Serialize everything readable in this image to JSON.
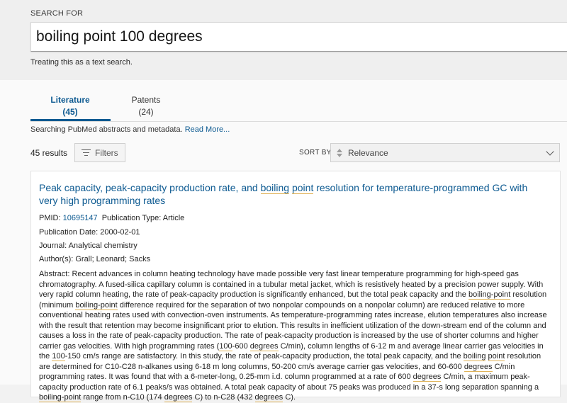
{
  "search": {
    "label": "SEARCH FOR",
    "query": "boiling point 100 degrees",
    "mode_note": "Treating this as a text search."
  },
  "tabs": [
    {
      "label": "Literature",
      "count": "(45)",
      "active": true
    },
    {
      "label": "Patents",
      "count": "(24)",
      "active": false
    }
  ],
  "source": {
    "text": "Searching PubMed abstracts and metadata.",
    "link": "Read More..."
  },
  "toolbar": {
    "results": "45 results",
    "filters_label": "Filters",
    "sort_label": "SORT BY",
    "sort_value": "Relevance"
  },
  "result": {
    "title": {
      "before": "Peak capacity, peak-capacity production rate, and ",
      "hl1": "boiling",
      "mid": " ",
      "hl2": "point",
      "after": " resolution for temperature-programmed GC with very high programming rates"
    },
    "pmid_label": "PMID:",
    "pmid": "10695147",
    "pub_type": "Publication Type: Article",
    "pub_date": "Publication Date: 2000-02-01",
    "journal": "Journal: Analytical chemistry",
    "authors": "Author(s): Grall; Leonard; Sacks",
    "abstract": {
      "s1": "Abstract: Recent advances in column heating technology have made possible very fast linear temperature programming for high-speed gas chromatography. A fused-silica capillary column is contained in a tubular metal jacket, which is resistively heated by a precision power supply. With very rapid column heating, the rate of peak-capacity production is significantly enhanced, but the total peak capacity and the ",
      "h1": "boiling-point",
      "s2": " resolution (minimum ",
      "h2": "boiling-point",
      "s3": " difference required for the separation of two nonpolar compounds on a nonpolar column) are reduced relative to more conventional heating rates used with convection-oven instruments. As temperature-programming rates increase, elution temperatures also increase with the result that retention may become insignificant prior to elution. This results in inefficient utilization of the down-stream end of the column and causes a loss in the rate of peak-capacity production. The rate of peak-capacity production is increased by the use of shorter columns and higher carrier gas velocities. With high programming rates (",
      "h3": "100",
      "s4": "-600 ",
      "h4": "degrees",
      "s5": " C/min), column lengths of 6-12 m and average linear carrier gas velocities in the ",
      "h5": "100",
      "s6": "-150 cm/s range are satisfactory. In this study, the rate of peak-capacity production, the total peak capacity, and the ",
      "h6": "boiling",
      "s7": " ",
      "h7": "point",
      "s8": " resolution are determined for C10-C28 n-alkanes using 6-18 m long columns, 50-200 cm/s average carrier gas velocities, and 60-600 ",
      "h8": "degrees",
      "s9": " C/min programming rates. It was found that with a 6-meter-long, 0.25-mm i.d. column programmed at a rate of 600 ",
      "h9": "degrees",
      "s10": " C/min, a maximum peak-capacity production rate of 6.1 peaks/s was obtained. A total peak capacity of about 75 peaks was produced in a 37-s long separation spanning a ",
      "h10": "boiling-point",
      "s11": " range from n-C10 (174 ",
      "h11": "degrees",
      "s12": " C) to n-C28 (432 ",
      "h12": "degrees",
      "s13": " C)."
    }
  },
  "colors": {
    "link": "#0d5a91",
    "highlight_underline": "#e0b45a"
  }
}
